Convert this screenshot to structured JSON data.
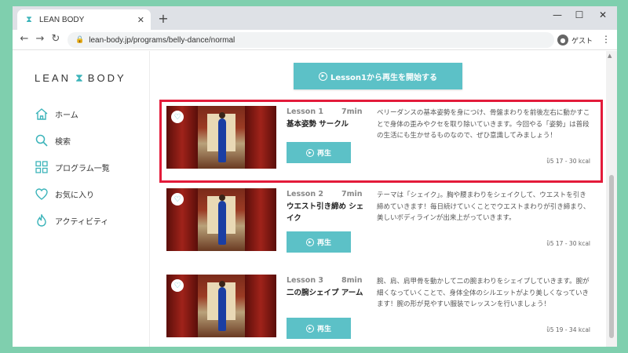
{
  "browser": {
    "tab_title": "LEAN BODY",
    "url": "lean-body.jp/programs/belly-dance/normal",
    "profile_label": "ゲスト"
  },
  "logo": {
    "left": "LEAN",
    "right": "BODY"
  },
  "sidebar": {
    "items": [
      {
        "label": "ホーム",
        "icon": "home-icon"
      },
      {
        "label": "検索",
        "icon": "search-icon"
      },
      {
        "label": "プログラム一覧",
        "icon": "grid-icon"
      },
      {
        "label": "お気に入り",
        "icon": "heart-icon"
      },
      {
        "label": "アクティビティ",
        "icon": "flame-icon"
      }
    ]
  },
  "cta": {
    "label": "Lesson1から再生を開始する"
  },
  "lessons": [
    {
      "number": "Lesson 1",
      "duration": "7min",
      "title": "基本姿勢 サークル",
      "play_label": "再生",
      "description": "ベリーダンスの基本姿勢を身につけ、骨盤まわりを前後左右に動かすことで身体の歪みやクセを取り除いていきます。今回やる「姿勢」は普段の生活にも生かせるものなので、ぜひ意識してみましょう！",
      "kcal": "17 - 30 kcal"
    },
    {
      "number": "Lesson 2",
      "duration": "7min",
      "title": "ウエスト引き締め シェイク",
      "play_label": "再生",
      "description": "テーマは「シェイク」。胸や腰まわりをシェイクして、ウエストを引き締めていきます！毎日続けていくことでウエストまわりが引き締まり、美しいボディラインが出来上がっていきます。",
      "kcal": "17 - 30 kcal"
    },
    {
      "number": "Lesson 3",
      "duration": "8min",
      "title": "二の腕シェイプ アーム",
      "play_label": "再生",
      "description": "腕、肩、肩甲骨を動かして二の腕まわりをシェイプしていきます。腕が細くなっていくことで、身体全体のシルエットがより美しくなっていきます！腕の形が見やすい服装でレッスンを行いましょう！",
      "kcal": "19 - 34 kcal"
    }
  ],
  "colors": {
    "accent": "#5cc1c7",
    "highlight": "#e31b3a",
    "background": "#7fcfae"
  }
}
